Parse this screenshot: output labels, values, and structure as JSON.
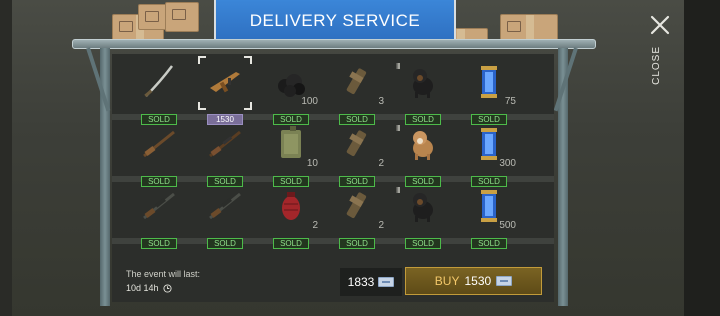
{
  "header": {
    "title": "DELIVERY SERVICE"
  },
  "close": {
    "label": "CLOSE",
    "icon": "close-x-icon"
  },
  "colors": {
    "sign_blue": "#3b86d8",
    "sold_green": "#4dbb4a",
    "price_purple": "#7a6e99",
    "buy_gold": "#c29b3a"
  },
  "shelves": [
    {
      "items": [
        {
          "icon": "sabre-icon",
          "tier": "",
          "qty": "",
          "tag": "SOLD",
          "selected": false
        },
        {
          "icon": "assault-rifle-icon",
          "tier": "",
          "qty": "",
          "tag": "1530",
          "selected": true
        },
        {
          "icon": "coal-pile-icon",
          "tier": "",
          "qty": "100",
          "tag": "SOLD",
          "selected": false
        },
        {
          "icon": "silencer-icon",
          "tier": "",
          "qty": "3",
          "tag": "SOLD",
          "selected": false
        },
        {
          "icon": "black-dog-icon",
          "tier": "III",
          "qty": "",
          "tag": "SOLD",
          "selected": false
        },
        {
          "icon": "energy-capsule-icon",
          "tier": "",
          "qty": "75",
          "tag": "SOLD",
          "selected": false
        }
      ]
    },
    {
      "items": [
        {
          "icon": "hunting-rifle-icon",
          "tier": "",
          "qty": "",
          "tag": "SOLD",
          "selected": false
        },
        {
          "icon": "sniper-rifle-icon",
          "tier": "",
          "qty": "",
          "tag": "SOLD",
          "selected": false
        },
        {
          "icon": "jerrycan-icon",
          "tier": "",
          "qty": "10",
          "tag": "SOLD",
          "selected": false
        },
        {
          "icon": "silencer-icon",
          "tier": "",
          "qty": "2",
          "tag": "SOLD",
          "selected": false
        },
        {
          "icon": "tan-dog-icon",
          "tier": "III",
          "qty": "",
          "tag": "SOLD",
          "selected": false
        },
        {
          "icon": "energy-capsule-icon",
          "tier": "",
          "qty": "300",
          "tag": "SOLD",
          "selected": false
        }
      ]
    },
    {
      "items": [
        {
          "icon": "scoped-rifle-icon",
          "tier": "",
          "qty": "",
          "tag": "SOLD",
          "selected": false
        },
        {
          "icon": "scoped-rifle-icon",
          "tier": "",
          "qty": "",
          "tag": "SOLD",
          "selected": false
        },
        {
          "icon": "red-grenade-icon",
          "tier": "",
          "qty": "2",
          "tag": "SOLD",
          "selected": false
        },
        {
          "icon": "silencer-icon",
          "tier": "",
          "qty": "2",
          "tag": "SOLD",
          "selected": false
        },
        {
          "icon": "black-dog-icon",
          "tier": "III",
          "qty": "",
          "tag": "SOLD",
          "selected": false
        },
        {
          "icon": "energy-capsule-icon",
          "tier": "",
          "qty": "500",
          "tag": "SOLD",
          "selected": false
        }
      ]
    }
  ],
  "footer": {
    "event_label": "The event will last:",
    "event_time": "10d 14h",
    "balance": "1833",
    "buy_label": "BUY",
    "buy_price": "1530"
  }
}
